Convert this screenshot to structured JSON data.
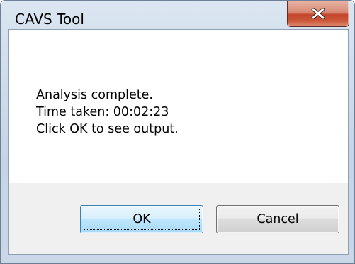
{
  "window": {
    "title": "CAVS Tool",
    "close_glyph": "close-icon"
  },
  "message": {
    "line1": "Analysis complete.",
    "line2": "Time taken: 00:02:23",
    "line3": "Click OK to see output."
  },
  "buttons": {
    "ok_label": "OK",
    "cancel_label": "Cancel"
  },
  "colors": {
    "close_button": "#c4452a",
    "default_button_border": "#3c7fb1"
  }
}
